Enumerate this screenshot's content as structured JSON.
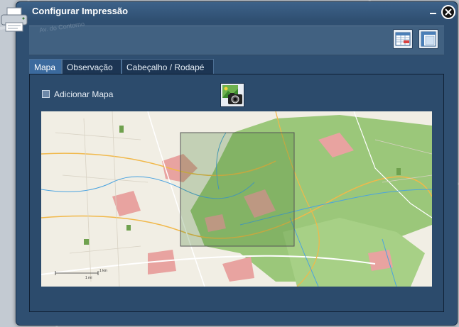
{
  "dialog": {
    "title": "Configurar Impressão"
  },
  "toolbar": {
    "buttons": [
      {
        "icon": "print-layout-icon"
      },
      {
        "icon": "page-layout-icon"
      }
    ]
  },
  "tabs": [
    {
      "label": "Mapa",
      "active": true
    },
    {
      "label": "Observação",
      "active": false
    },
    {
      "label": "Cabeçalho / Rodapé",
      "active": false
    }
  ],
  "map_tab": {
    "add_map_label": "Adicionar Mapa",
    "add_map_checked": false,
    "capture_icon": "camera-icon",
    "scale_labels": [
      "1 km",
      "1 mi"
    ]
  },
  "background_map": {
    "street_label": "Av. do Contorno"
  },
  "colors": {
    "dialog_bg": "#2f4f71",
    "tab_active": "#3b6a9e",
    "park_green": "#9bc77a",
    "urban_pink": "#e8a3a0"
  }
}
